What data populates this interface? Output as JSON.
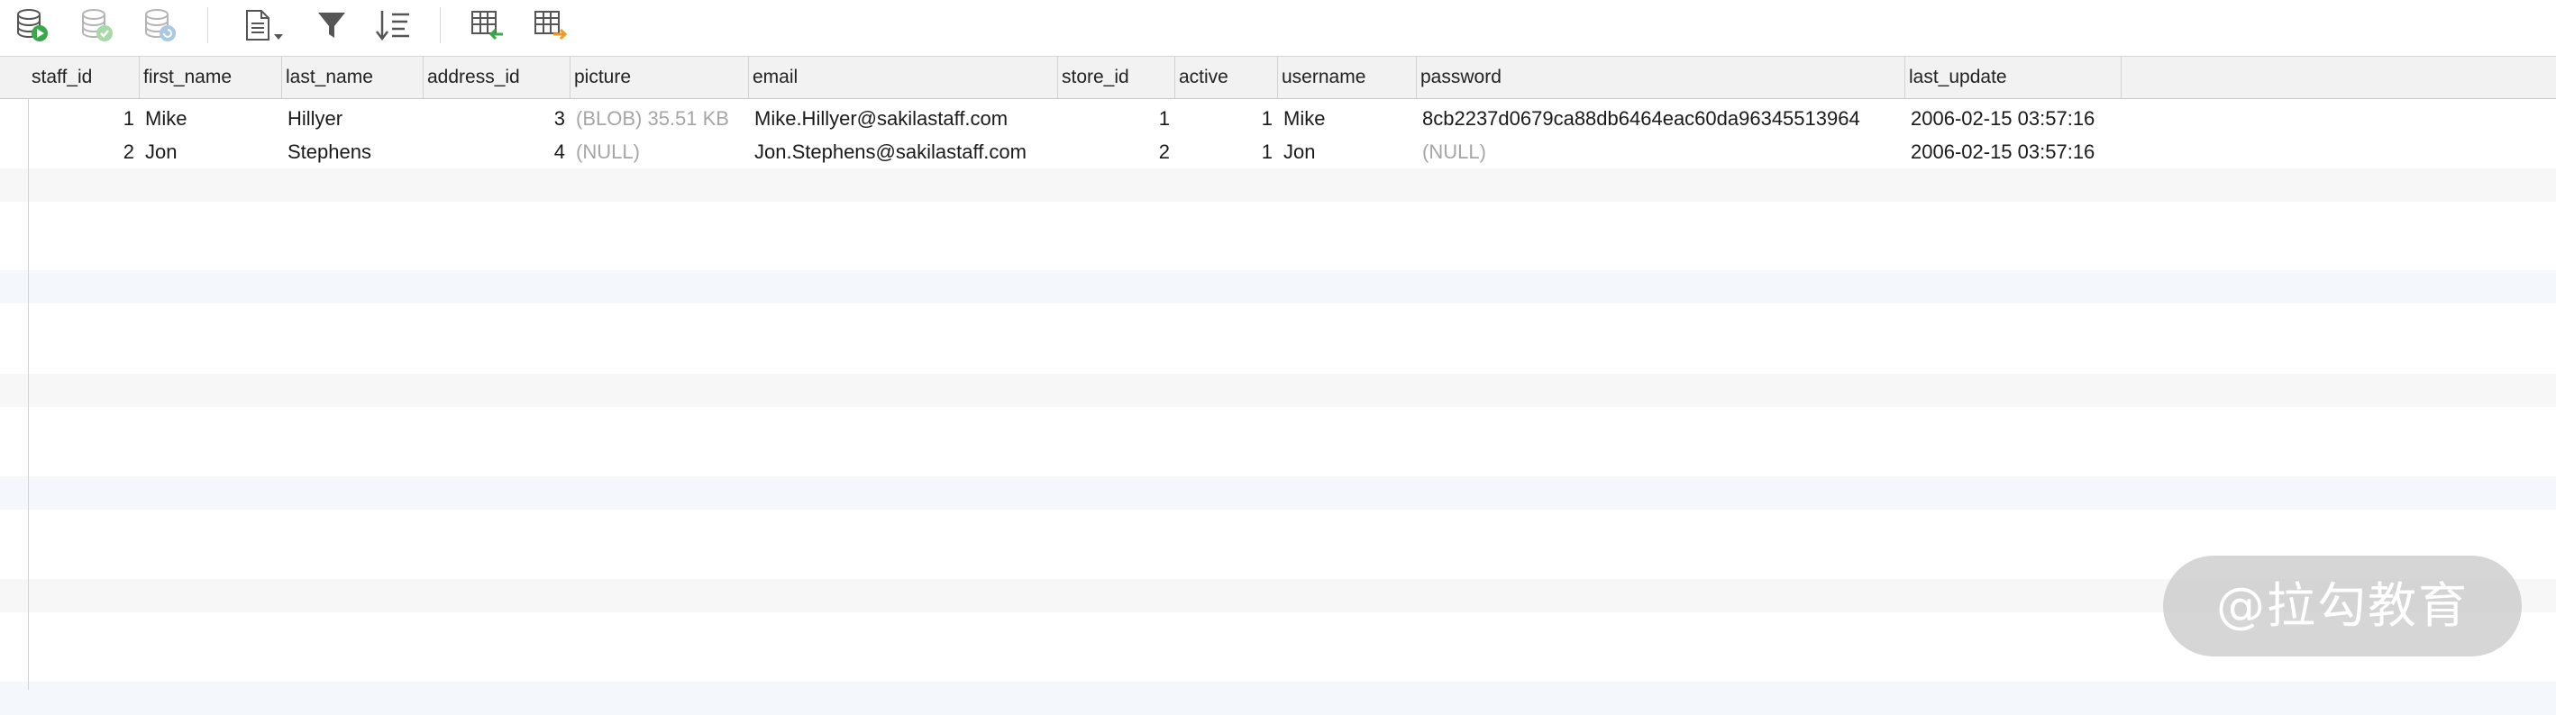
{
  "toolbar": {
    "icons": [
      "execute-query-icon",
      "commit-icon",
      "rollback-icon",
      "export-icon",
      "filter-icon",
      "sort-icon",
      "import-table-icon",
      "export-table-icon"
    ]
  },
  "table": {
    "columns": [
      "staff_id",
      "first_name",
      "last_name",
      "address_id",
      "picture",
      "email",
      "store_id",
      "active",
      "username",
      "password",
      "last_update"
    ],
    "rows": [
      {
        "staff_id": "1",
        "first_name": "Mike",
        "last_name": "Hillyer",
        "address_id": "3",
        "picture": "(BLOB) 35.51 KB",
        "email": "Mike.Hillyer@sakilastaff.com",
        "store_id": "1",
        "active": "1",
        "username": "Mike",
        "password": "8cb2237d0679ca88db6464eac60da96345513964",
        "last_update": "2006-02-15 03:57:16"
      },
      {
        "staff_id": "2",
        "first_name": "Jon",
        "last_name": "Stephens",
        "address_id": "4",
        "picture": "(NULL)",
        "email": "Jon.Stephens@sakilastaff.com",
        "store_id": "2",
        "active": "1",
        "username": "Jon",
        "password": "(NULL)",
        "last_update": "2006-02-15 03:57:16"
      }
    ]
  },
  "watermark": "@拉勾教育",
  "colors": {
    "stripe": "#f6f9fc",
    "header": "#f2f2f2",
    "muted": "#a6a6a6",
    "play": "#3aa84a",
    "orange": "#f39a1e"
  }
}
